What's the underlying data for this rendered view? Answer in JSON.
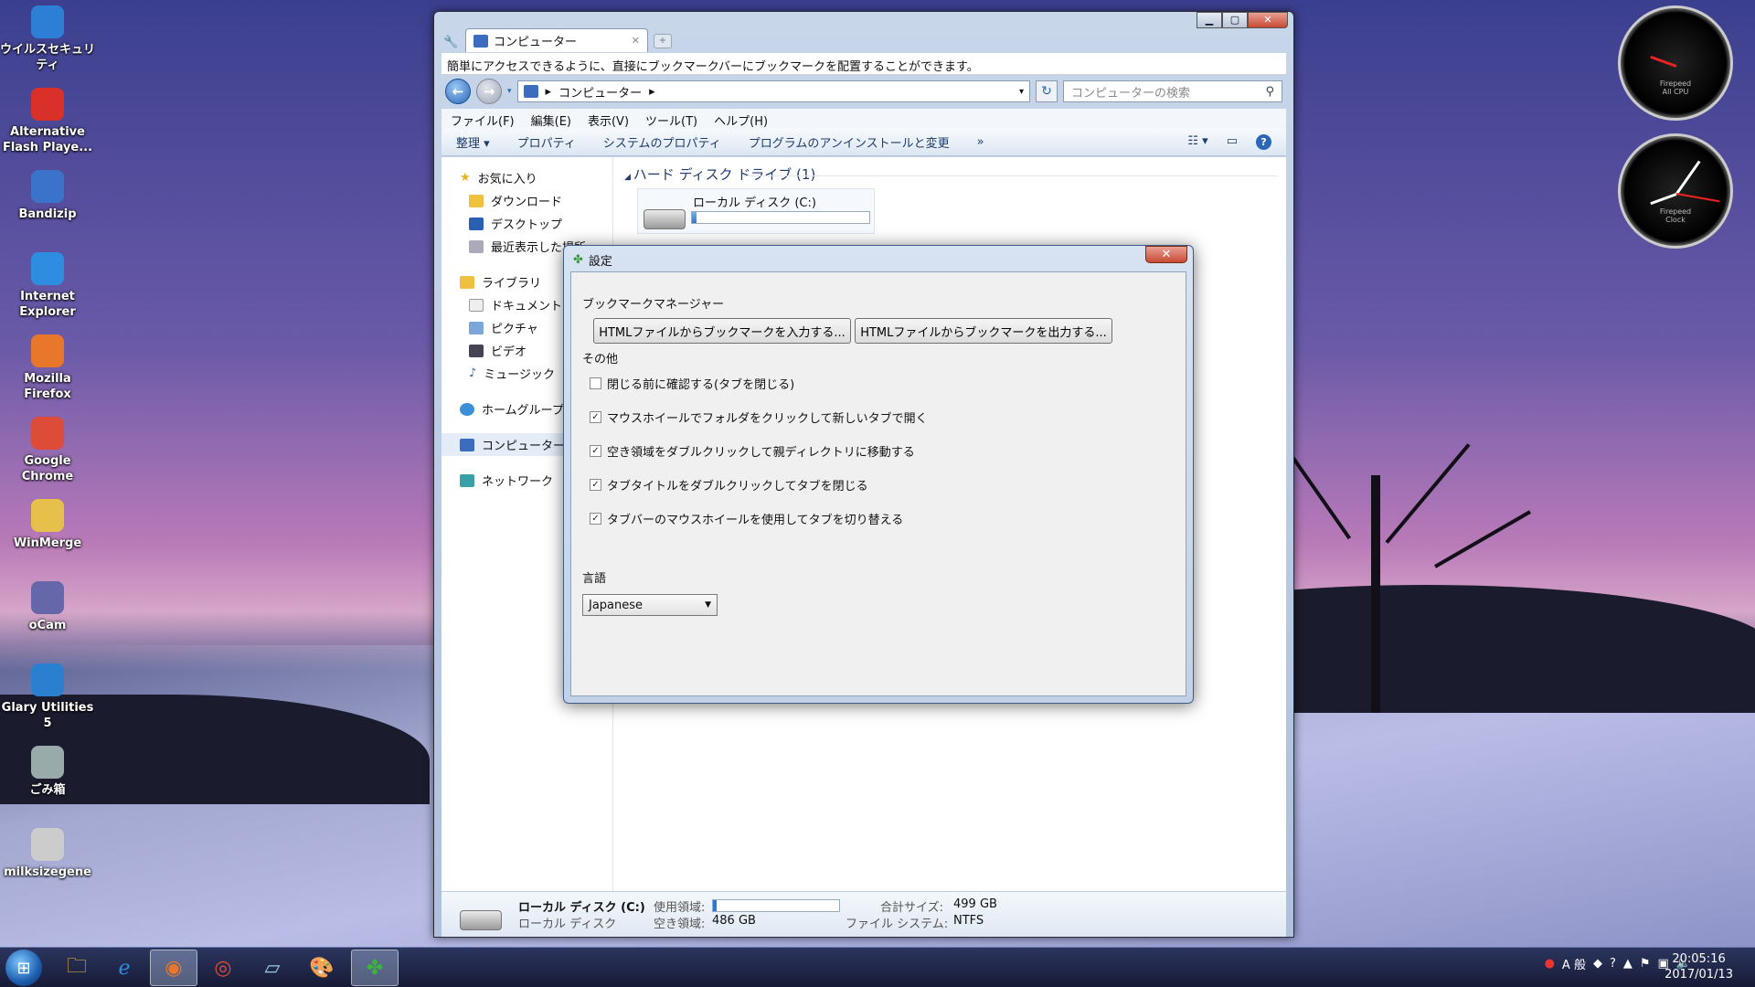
{
  "desktop": {
    "icons": [
      {
        "label": "ウイルスセキュリティ",
        "icon": "shield-icon",
        "color": "#2d7fd6"
      },
      {
        "label": "Alternative Flash Playe...",
        "icon": "flash-icon",
        "color": "#d9302a"
      },
      {
        "label": "Bandizip",
        "icon": "zip-icon",
        "color": "#3a73c9"
      },
      {
        "label": "Internet Explorer",
        "icon": "ie-icon",
        "color": "#2e8de0"
      },
      {
        "label": "Mozilla Firefox",
        "icon": "firefox-icon",
        "color": "#e8762b"
      },
      {
        "label": "Google Chrome",
        "icon": "chrome-icon",
        "color": "#dd4b39"
      },
      {
        "label": "WinMerge",
        "icon": "winmerge-icon",
        "color": "#e6c04a"
      },
      {
        "label": "oCam",
        "icon": "ocam-icon",
        "color": "#66a"
      },
      {
        "label": "Glary Utilities 5",
        "icon": "glary-icon",
        "color": "#2a7fd0"
      },
      {
        "label": "ごみ箱",
        "icon": "recycle-bin-icon",
        "color": "#9aa"
      },
      {
        "label": "milksizegene",
        "icon": "milk-icon",
        "color": "#ccc"
      }
    ]
  },
  "gadgets": {
    "cpu": {
      "line1": "Firepeed",
      "line2": "All CPU"
    },
    "clock": {
      "line1": "Firepeed",
      "line2": "Clock"
    }
  },
  "explorer": {
    "tab_title": "コンピューター",
    "info_text": "簡単にアクセスできるように、直接にブックマークバーにブックマークを配置することができます。",
    "address": "コンピューター",
    "search_placeholder": "コンピューターの検索",
    "menu": [
      "ファイル(F)",
      "編集(E)",
      "表示(V)",
      "ツール(T)",
      "ヘルプ(H)"
    ],
    "commands": [
      "整理 ▾",
      "プロパティ",
      "システムのプロパティ",
      "プログラムのアンインストールと変更",
      "»"
    ],
    "nav": {
      "favorites": "お気に入り",
      "downloads": "ダウンロード",
      "desktop": "デスクトップ",
      "recent": "最近表示した場所",
      "libraries": "ライブラリ",
      "documents": "ドキュメント",
      "pictures": "ピクチャ",
      "videos": "ビデオ",
      "music": "ミュージック",
      "homegroup": "ホームグループ",
      "computer": "コンピューター",
      "network": "ネットワーク"
    },
    "section_title": "ハード ディスク ドライブ (1)",
    "drive_name": "ローカル ディスク (C:)",
    "status": {
      "name": "ローカル ディスク (C:)",
      "type": "ローカル ディスク",
      "used_label": "使用領域:",
      "free_label": "空き領域:",
      "free_value": "486 GB",
      "total_label": "合計サイズ:",
      "total_value": "499 GB",
      "fs_label": "ファイル システム:",
      "fs_value": "NTFS"
    },
    "used_fraction": 0.026
  },
  "dialog": {
    "title": "設定",
    "close": "✕",
    "bookmark_group": "ブックマークマネージャー",
    "import_button": "HTMLファイルからブックマークを入力する...",
    "export_button": "HTMLファイルからブックマークを出力する...",
    "other_group": "その他",
    "options": [
      {
        "label": "閉じる前に確認する(タブを閉じる)",
        "checked": false
      },
      {
        "label": "マウスホイールでフォルダをクリックして新しいタブで開く",
        "checked": true
      },
      {
        "label": "空き領域をダブルクリックして親ディレクトリに移動する",
        "checked": true
      },
      {
        "label": "タブタイトルをダブルクリックしてタブを閉じる",
        "checked": true
      },
      {
        "label": "タブバーのマウスホイールを使用してタブを切り替える",
        "checked": true
      }
    ],
    "language_group": "言語",
    "language_value": "Japanese"
  },
  "taskbar": {
    "ime": "A 般",
    "time": "20:05:16",
    "date": "2017/01/13"
  }
}
